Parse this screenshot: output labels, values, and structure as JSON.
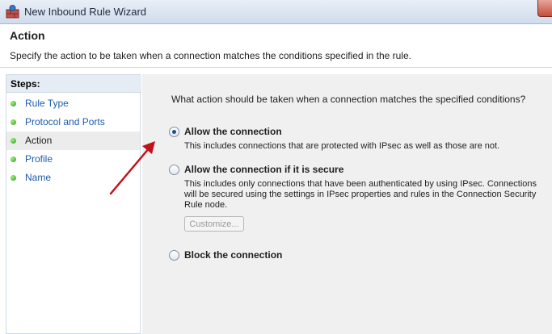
{
  "window": {
    "title": "New Inbound Rule Wizard"
  },
  "header": {
    "title": "Action",
    "description": "Specify the action to be taken when a connection matches the conditions specified in the rule."
  },
  "steps": {
    "heading": "Steps:",
    "items": [
      {
        "label": "Rule Type"
      },
      {
        "label": "Protocol and Ports"
      },
      {
        "label": "Action"
      },
      {
        "label": "Profile"
      },
      {
        "label": "Name"
      }
    ]
  },
  "main": {
    "question": "What action should be taken when a connection matches the specified conditions?",
    "options": [
      {
        "label": "Allow the connection",
        "desc": "This includes connections that are protected with IPsec as well as those are not.",
        "selected": true
      },
      {
        "label": "Allow the connection if it is secure",
        "desc_lines": [
          "This includes only connections that have been authenticated by using IPsec.  Connections",
          "will be secured using the settings in IPsec properties and rules in the Connection Security",
          "Rule node."
        ],
        "selected": false
      },
      {
        "label": "Block the connection",
        "selected": false
      }
    ],
    "customize_label": "Customize..."
  },
  "colors": {
    "accent_link": "#1c5bb0",
    "annotation_arrow": "#c0121b",
    "step_dot": "#2f9a18"
  }
}
